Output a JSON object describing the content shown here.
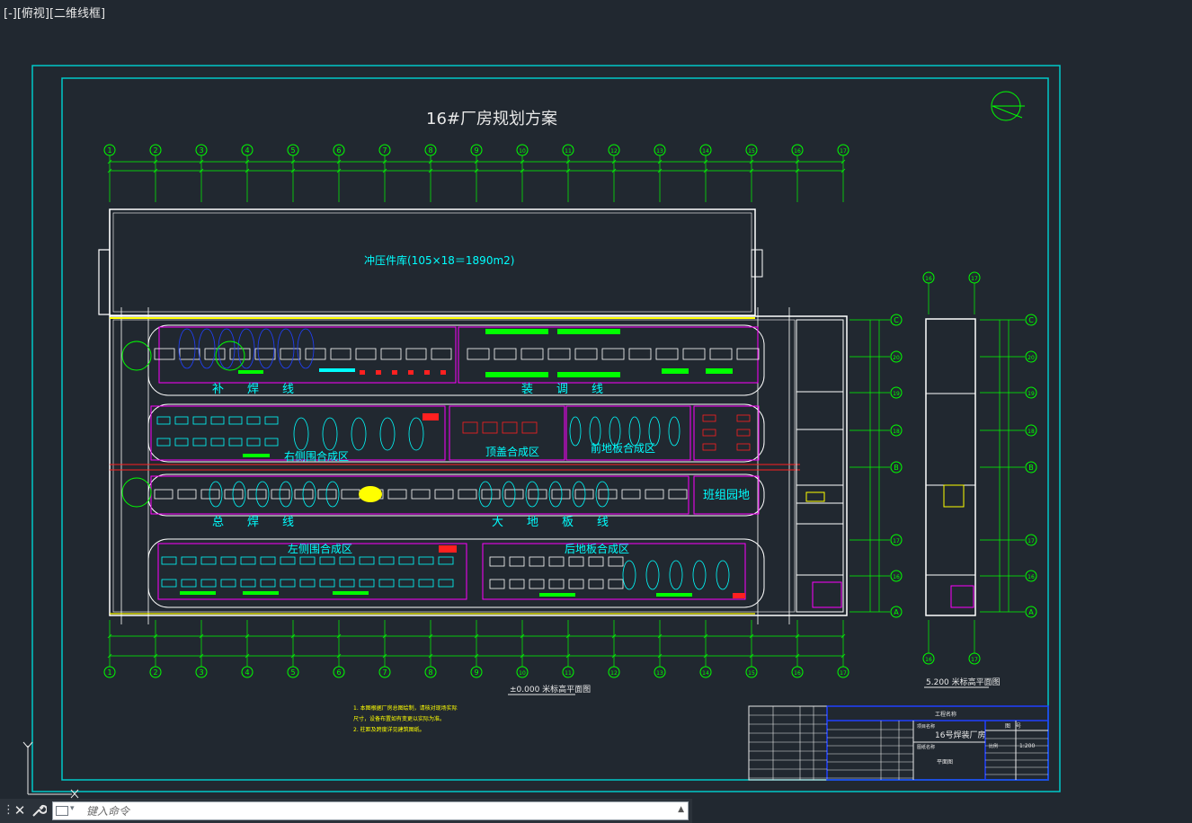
{
  "viewport_label": "[-][俯视][二维线框]",
  "colors": {
    "background": "#212830",
    "frame": "#00c8c8",
    "walls": "#ffffff",
    "grid": "#00ff00",
    "magenta": "#ff00ff",
    "cyan": "#00ffff",
    "yellow": "#ffff00",
    "red": "#ff2020",
    "blue": "#2040ff"
  },
  "drawing": {
    "title": "16#厂房规划方案",
    "grid_axes_top": [
      "1",
      "2",
      "3",
      "4",
      "5",
      "6",
      "7",
      "8",
      "9",
      "10",
      "11",
      "12",
      "13",
      "14",
      "15",
      "16",
      "17"
    ],
    "grid_axes_bottom": [
      "1",
      "2",
      "3",
      "4",
      "5",
      "6",
      "7",
      "8",
      "9",
      "10",
      "11",
      "12",
      "13",
      "14",
      "15",
      "16",
      "17"
    ],
    "grid_axes_right": [
      "C",
      "20",
      "19",
      "18",
      "B",
      "17",
      "16",
      "A"
    ],
    "mezz_axes_top": [
      "16",
      "17"
    ],
    "mezz_axes_bottom": [
      "16",
      "17"
    ],
    "mezz_axes_right": [
      "C",
      "20",
      "19",
      "18",
      "B",
      "17",
      "16",
      "A"
    ],
    "zones": {
      "warehouse": "冲压件库(105×18＝1890m2)",
      "line_buhan": "补　　焊　　线",
      "line_zhuangtiao": "装　　调　　线",
      "right_side_zone": "右侧围合成区",
      "roof_zone": "顶盖合成区",
      "front_floor_zone": "前地板合成区",
      "line_zonghan": "总　　焊　　线",
      "line_dadiban": "大　　地　　板　　线",
      "team_area": "班组园地",
      "left_side_zone": "左侧围合成区",
      "rear_floor_zone": "后地板合成区"
    },
    "plan_caption_main": "±0.000 米标高平面图",
    "plan_caption_mezz": "5.200 米标高平面图",
    "notes": [
      "1. 本图根据厂房总图绘制，请核对现场实际",
      "尺寸，设备布置如有变更以实际为准。",
      "2. 柱距及跨度详见建筑图纸。"
    ],
    "title_block": {
      "project_label": "项目名称",
      "project_name": "16号焊装厂房",
      "drawing_label": "图纸名称",
      "drawing_name": "平面图",
      "scale_label": "比例",
      "scale_value": "1:200",
      "section_header": "工程名称",
      "section_header2": "图　号"
    }
  },
  "command_line": {
    "placeholder": "键入命令"
  }
}
